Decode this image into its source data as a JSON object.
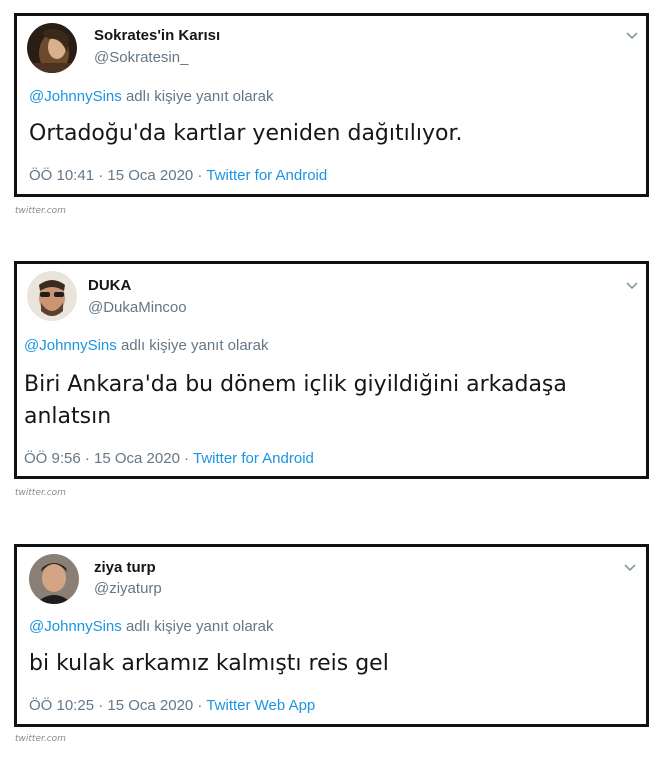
{
  "tweets": [
    {
      "name": "Sokrates'in Karısı",
      "handle": "@Sokratesin_",
      "reply_mention": "@JohnnySins",
      "reply_suffix": " adlı kişiye yanıt olarak",
      "text": "Ortadoğu'da kartlar yeniden dağıtılıyor.",
      "time": "ÖÖ 10:41 · 15 Oca 2020 · ",
      "source": "Twitter for Android",
      "credit": "twitter.com",
      "avatar_icon": "avatar-woman-photo"
    },
    {
      "name": "DUKA",
      "handle": "@DukaMincoo",
      "reply_mention": "@JohnnySins",
      "reply_suffix": " adlı kişiye yanıt olarak",
      "text": "Biri Ankara'da bu dönem içlik giyildiğini arkadaşa anlatsın",
      "time": "ÖÖ 9:56 · 15 Oca 2020 · ",
      "source": "Twitter for Android",
      "credit": "twitter.com",
      "avatar_icon": "avatar-bearded-man-sunglasses"
    },
    {
      "name": "ziya turp",
      "handle": "@ziyaturp",
      "reply_mention": "@JohnnySins",
      "reply_suffix": " adlı kişiye yanıt olarak",
      "text": "bi kulak arkamız kalmıştı reis gel",
      "time": "ÖÖ 10:25 · 15 Oca 2020 · ",
      "source": "Twitter Web App",
      "credit": "twitter.com",
      "avatar_icon": "avatar-young-man-photo"
    }
  ],
  "colors": {
    "link": "#1b95e0",
    "secondary_text": "#657786",
    "primary_text": "#14171a",
    "card_border": "#111111"
  }
}
